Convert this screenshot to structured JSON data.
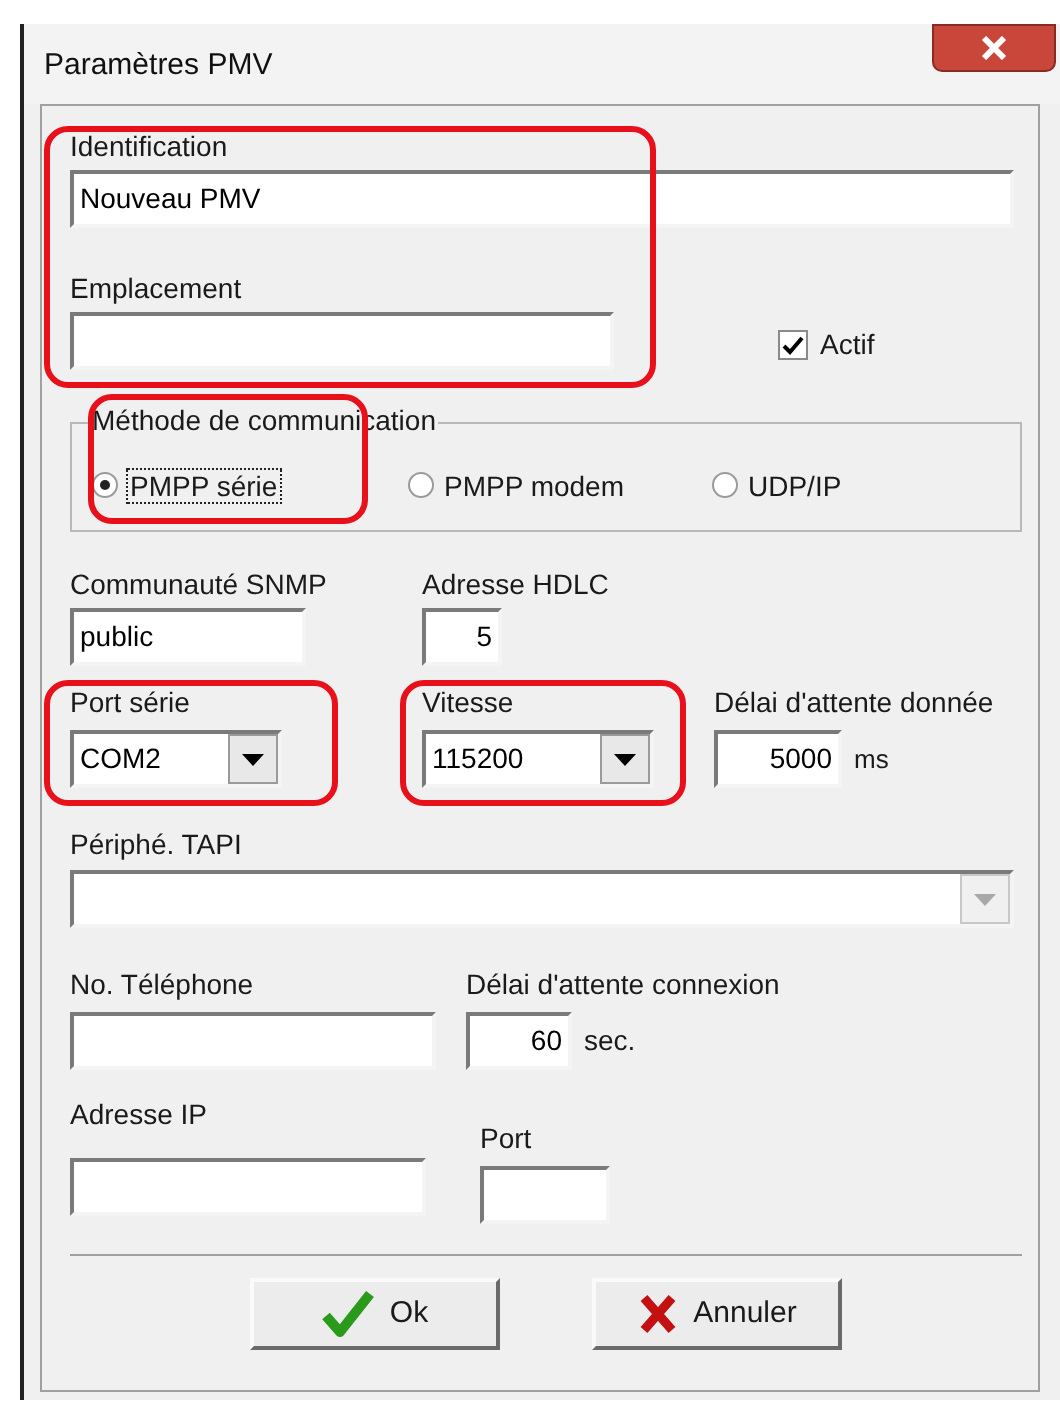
{
  "window": {
    "title": "Paramètres PMV"
  },
  "identification": {
    "label": "Identification",
    "value": "Nouveau PMV"
  },
  "emplacement": {
    "label": "Emplacement"
  },
  "actif": {
    "label": "Actif",
    "checked": true
  },
  "communication": {
    "legend": "Méthode de communication",
    "options": [
      {
        "label": "PMPP série",
        "selected": true
      },
      {
        "label": "PMPP modem",
        "selected": false
      },
      {
        "label": "UDP/IP",
        "selected": false
      }
    ]
  },
  "snmp": {
    "label": "Communauté SNMP",
    "value": "public"
  },
  "hdlc": {
    "label": "Adresse HDLC",
    "value": "5"
  },
  "port_serie": {
    "label": "Port série",
    "value": "COM2"
  },
  "vitesse": {
    "label": "Vitesse",
    "value": "115200"
  },
  "delai_donnee": {
    "label": "Délai d'attente donnée",
    "value": "5000",
    "unit": "ms"
  },
  "tapi": {
    "label": "Périphé. TAPI",
    "disabled": true
  },
  "telephone": {
    "label": "No. Téléphone"
  },
  "delai_connexion": {
    "label": "Délai d'attente connexion",
    "value": "60",
    "unit": "sec."
  },
  "adresse_ip": {
    "label": "Adresse IP"
  },
  "port": {
    "label": "Port"
  },
  "buttons": [
    {
      "kind": "ok",
      "label": "Ok"
    },
    {
      "kind": "cancel",
      "label": "Annuler"
    }
  ]
}
